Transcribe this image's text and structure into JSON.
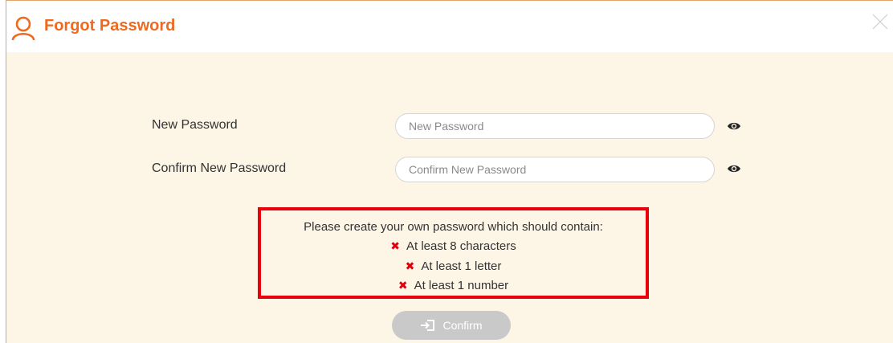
{
  "dialog": {
    "title": "Forgot Password",
    "title_icon": "user-icon",
    "close_icon": "close-icon",
    "accent_color": "#ee6a1f"
  },
  "form": {
    "new_password": {
      "label": "New Password",
      "placeholder": "New Password",
      "value": "",
      "toggle_icon": "eye-icon"
    },
    "confirm_password": {
      "label": "Confirm New Password",
      "placeholder": "Confirm New Password",
      "value": "",
      "toggle_icon": "eye-icon"
    }
  },
  "requirements": {
    "intro": "Please create your own password which should contain:",
    "status_icon": "cross-icon",
    "status_color": "#e0000b",
    "items": [
      {
        "text": "At least 8 characters",
        "met": false
      },
      {
        "text": "At least 1 letter",
        "met": false
      },
      {
        "text": "At least 1 number",
        "met": false
      }
    ]
  },
  "confirm_button": {
    "label": "Confirm",
    "icon": "sign-in-icon",
    "enabled": false
  }
}
